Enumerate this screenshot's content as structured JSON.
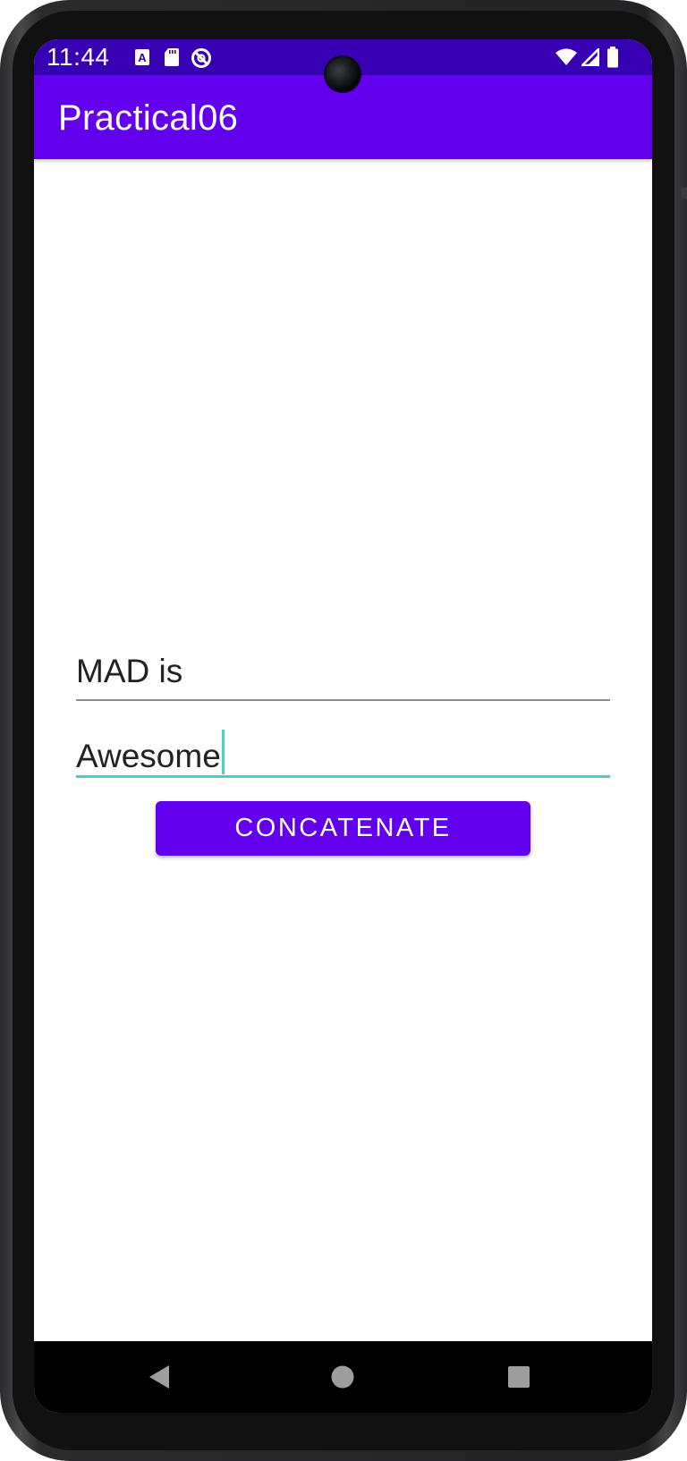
{
  "status_bar": {
    "time": "11:44",
    "left_icons": [
      "text-a-icon",
      "sd-card-icon",
      "do-not-disturb-icon"
    ],
    "right_icons": [
      "wifi-icon",
      "cellular-signal-icon",
      "battery-icon"
    ]
  },
  "app_bar": {
    "title": "Practical06"
  },
  "form": {
    "input1": {
      "value": "MAD is"
    },
    "input2": {
      "value": "Awesome"
    },
    "button_label": "CONCATENATE"
  },
  "nav_bar": {
    "buttons": [
      "back-icon",
      "home-icon",
      "recents-icon"
    ]
  },
  "colors": {
    "status_bar": "#3700b3",
    "primary": "#6200ee",
    "accent": "#4ecdc4",
    "text": "#222222"
  }
}
